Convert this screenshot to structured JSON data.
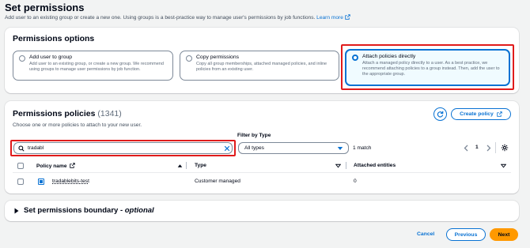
{
  "page": {
    "title": "Set permissions",
    "description": "Add user to an existing group or create a new one. Using groups is a best-practice way to manage user's permissions by job functions.",
    "learn_more": "Learn more"
  },
  "options": {
    "heading": "Permissions options",
    "tiles": [
      {
        "title": "Add user to group",
        "desc": "Add user to an existing group, or create a new group. We recommend using groups to manage user permissions by job function.",
        "selected": false
      },
      {
        "title": "Copy permissions",
        "desc": "Copy all group memberships, attached managed policies, and inline policies from an existing user.",
        "selected": false
      },
      {
        "title": "Attach policies directly",
        "desc": "Attach a managed policy directly to a user. As a best practice, we recommend attaching policies to a group instead. Then, add the user to the appropriate group.",
        "selected": true
      }
    ]
  },
  "policies": {
    "heading": "Permissions policies",
    "count": "(1341)",
    "subtitle": "Choose one or more policies to attach to your new user.",
    "create_policy": "Create policy",
    "search_value": "tradabl",
    "filter_label": "Filter by Type",
    "filter_value": "All types",
    "match_text": "1 match",
    "page_number": "1",
    "columns": {
      "name": "Policy name",
      "type": "Type",
      "attached": "Attached entities"
    },
    "rows": [
      {
        "name": "tradablebits-test",
        "type": "Customer managed",
        "attached": "0"
      }
    ]
  },
  "boundary": {
    "title": "Set permissions boundary - ",
    "optional": "optional"
  },
  "footer": {
    "cancel": "Cancel",
    "previous": "Previous",
    "next": "Next"
  },
  "colors": {
    "accent": "#0972d3",
    "primary_button": "#ff9900",
    "highlight_box": "#e01b1b"
  },
  "icons": [
    "external-link-icon",
    "refresh-icon",
    "search-icon",
    "clear-icon",
    "dropdown-caret-icon",
    "chevron-left-icon",
    "chevron-right-icon",
    "settings-gear-icon",
    "sort-asc-icon",
    "sort-desc-icon",
    "policy-expand-icon",
    "caret-right-icon"
  ]
}
